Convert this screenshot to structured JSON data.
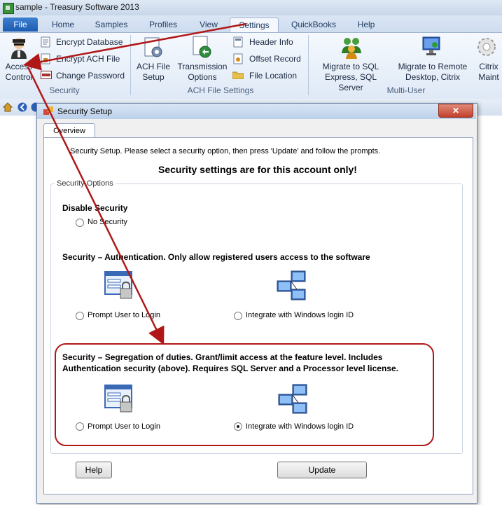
{
  "window": {
    "title": "sample - Treasury Software 2013"
  },
  "ribbon": {
    "tabs": [
      "File",
      "Home",
      "Samples",
      "Profiles",
      "View",
      "Settings",
      "QuickBooks",
      "Help"
    ],
    "active_tab": "Settings",
    "security_group": {
      "label": "Security",
      "access_control": "Access Control",
      "encrypt_database": "Encrypt Database",
      "encrypt_ach_file": "Encrypt ACH File",
      "change_password": "Change Password"
    },
    "ach_group": {
      "label": "ACH File Settings",
      "ach_file_setup": "ACH File Setup",
      "transmission_options": "Transmission Options",
      "header_info": "Header Info",
      "offset_record": "Offset Record",
      "file_location": "File Location"
    },
    "multiuser_group": {
      "label": "Multi-User",
      "migrate_sql": "Migrate to SQL Express, SQL Server",
      "migrate_remote": "Migrate to Remote Desktop, Citrix",
      "citrix": "Citrix Maint"
    }
  },
  "dialog": {
    "title": "Security Setup",
    "tab": "Overview",
    "instruction": "Security Setup.  Please select a security option, then press 'Update' and follow the prompts.",
    "headline": "Security settings are for this account only!",
    "fieldset_label": "Security Options",
    "disable_heading": "Disable Security",
    "no_security": "No Security",
    "auth_heading": "Security – Authentication.  Only allow registered users access to the software",
    "auth_prompt": "Prompt User to Login",
    "auth_windows": "Integrate with Windows login ID",
    "seg_heading_1": "Security – Segregation of duties. Grant/limit access at the feature level.  Includes",
    "seg_heading_2": "Authentication security (above). Requires SQL Server and a Processor level license.",
    "seg_prompt": "Prompt User to Login",
    "seg_windows": "Integrate with Windows login ID",
    "help_button": "Help",
    "update_button": "Update"
  },
  "selected_option": "seg_windows",
  "colors": {
    "annotation_red": "#b01818",
    "ribbon_blue": "#dfe9f6"
  }
}
